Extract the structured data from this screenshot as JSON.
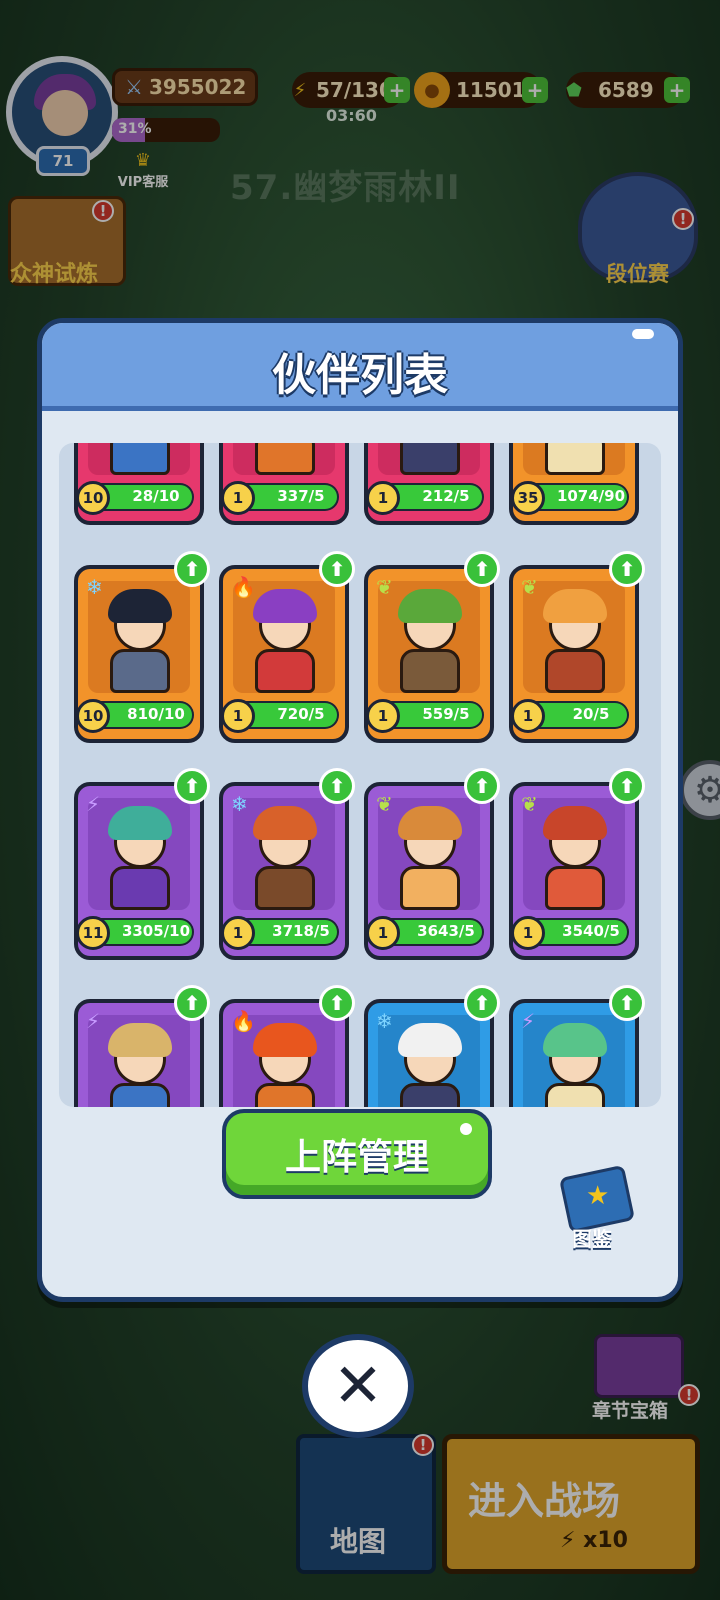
{
  "hud": {
    "level": "71",
    "power": "3955022",
    "exp_percent": "31%",
    "exp_fraction": 0.31,
    "vip_label": "VIP客服",
    "energy": "57/130",
    "energy_timer": "03:60",
    "gold": "11501",
    "gems": "6589",
    "stage_title": "57.幽梦雨林II",
    "gods_trial_label": "众神试炼",
    "ranked_label": "段位赛",
    "chapter_chest_label": "章节宝箱",
    "map_label": "地图",
    "battle_label": "进入战场",
    "battle_cost": "x10",
    "alert_mark": "!"
  },
  "modal": {
    "title": "伙伴列表",
    "manage_button": "上阵管理",
    "codex_label": "图鉴",
    "close_symbol": "✕"
  },
  "partners": [
    {
      "rarity": "pink",
      "element": "",
      "star": "10",
      "count": "28/10",
      "fill": 1.0,
      "upgrade": false
    },
    {
      "rarity": "pink",
      "element": "",
      "star": "1",
      "count": "337/5",
      "fill": 1.0,
      "upgrade": false
    },
    {
      "rarity": "pink",
      "element": "",
      "star": "1",
      "count": "212/5",
      "fill": 1.0,
      "upgrade": false
    },
    {
      "rarity": "orange",
      "element": "",
      "star": "35",
      "count": "1074/90",
      "fill": 1.0,
      "upgrade": false
    },
    {
      "rarity": "orange",
      "element": "ice-crystal-icon",
      "star": "10",
      "count": "810/10",
      "fill": 1.0,
      "upgrade": true
    },
    {
      "rarity": "orange",
      "element": "fire-icon",
      "star": "1",
      "count": "720/5",
      "fill": 1.0,
      "upgrade": true
    },
    {
      "rarity": "orange",
      "element": "leaf-icon",
      "star": "1",
      "count": "559/5",
      "fill": 1.0,
      "upgrade": true
    },
    {
      "rarity": "orange",
      "element": "leaf-icon",
      "star": "1",
      "count": "20/5",
      "fill": 1.0,
      "upgrade": true
    },
    {
      "rarity": "purple",
      "element": "lightning-icon",
      "star": "11",
      "count": "3305/10",
      "fill": 1.0,
      "upgrade": true
    },
    {
      "rarity": "purple",
      "element": "ice-crystal-icon",
      "star": "1",
      "count": "3718/5",
      "fill": 1.0,
      "upgrade": true
    },
    {
      "rarity": "purple",
      "element": "leaf-icon",
      "star": "1",
      "count": "3643/5",
      "fill": 1.0,
      "upgrade": true
    },
    {
      "rarity": "purple",
      "element": "leaf-icon",
      "star": "1",
      "count": "3540/5",
      "fill": 1.0,
      "upgrade": true
    },
    {
      "rarity": "purple",
      "element": "lightning-icon",
      "star": "",
      "count": "",
      "fill": 1.0,
      "upgrade": true
    },
    {
      "rarity": "purple",
      "element": "fire-icon",
      "star": "",
      "count": "",
      "fill": 1.0,
      "upgrade": true
    },
    {
      "rarity": "blue",
      "element": "ice-crystal-icon",
      "star": "",
      "count": "",
      "fill": 1.0,
      "upgrade": true
    },
    {
      "rarity": "blue",
      "element": "lightning-icon",
      "star": "",
      "count": "",
      "fill": 1.0,
      "upgrade": true
    }
  ],
  "colors": {
    "pink": "#e6386d",
    "orange": "#f2932a",
    "purple": "#9b5bd6",
    "blue": "#2f9ce6",
    "accent_green": "#39c13a",
    "panel_blue": "#6f9fe0"
  }
}
